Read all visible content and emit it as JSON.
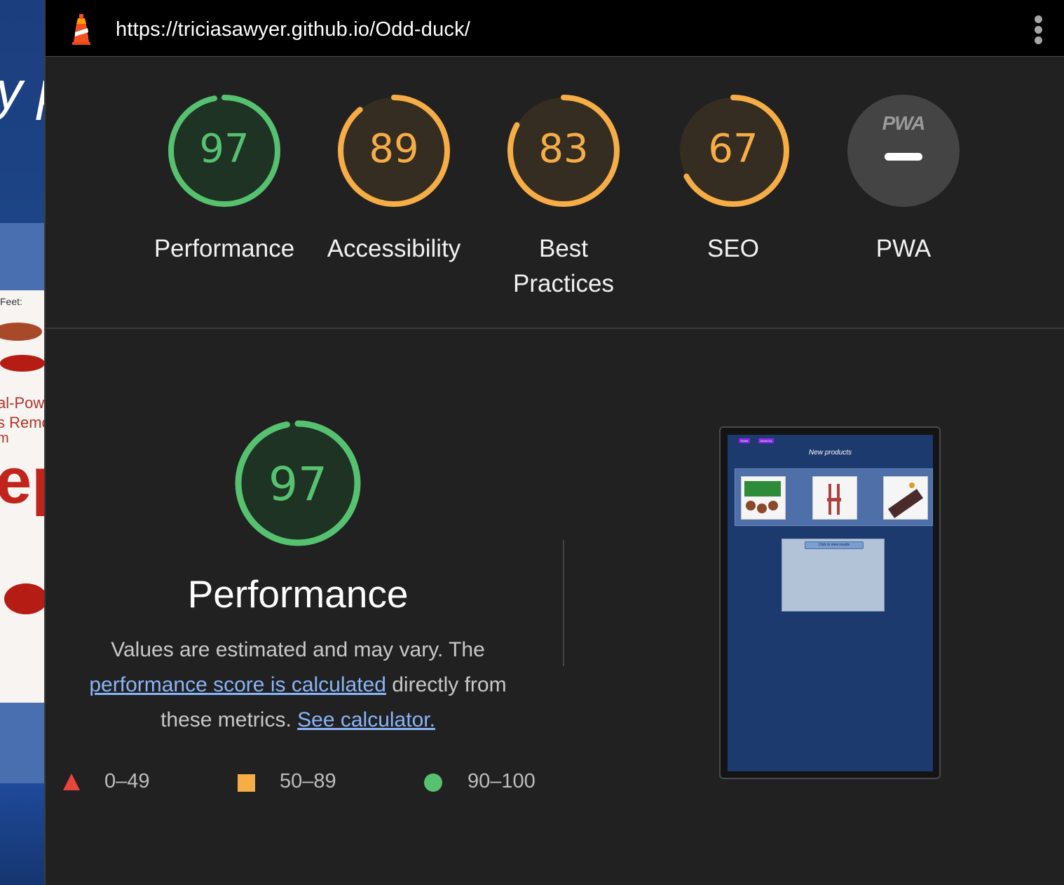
{
  "background_page": {
    "heading_fragment": "y p",
    "photo_texts": [
      "Feet:",
      "al-Pow",
      "s Remo",
      "m",
      "ep"
    ]
  },
  "toolbar": {
    "url": "https://triciasawyer.github.io/Odd-duck/",
    "logo_icon": "lighthouse-icon",
    "menu_icon": "kebab-menu-icon"
  },
  "scores": [
    {
      "label": "Performance",
      "score": "97",
      "value": 97,
      "status": "pass",
      "color": "#56c270",
      "ring_bg": "#1f3325"
    },
    {
      "label": "Accessibility",
      "score": "89",
      "value": 89,
      "status": "average",
      "color": "#f6ad45",
      "ring_bg": "#352d22"
    },
    {
      "label": "Best Practices",
      "label_line1": "Best",
      "label_line2": "Practices",
      "score": "83",
      "value": 83,
      "status": "average",
      "color": "#f6ad45",
      "ring_bg": "#352d22"
    },
    {
      "label": "SEO",
      "score": "67",
      "value": 67,
      "status": "average",
      "color": "#f6ad45",
      "ring_bg": "#352d22"
    },
    {
      "label": "PWA",
      "badge_text": "PWA",
      "status": "not-applicable",
      "color": "#444444"
    }
  ],
  "detail": {
    "score": "97",
    "value": 97,
    "title": "Performance",
    "desc_part1": "Values are estimated and may vary. The",
    "link1": "performance score is calculated",
    "desc_part2": " directly from these metrics.",
    "link2": "See calculator."
  },
  "legend": [
    {
      "range": "0–49",
      "shape": "triangle",
      "color": "#e8453c"
    },
    {
      "range": "50–89",
      "shape": "square",
      "color": "#f6ad45"
    },
    {
      "range": "90–100",
      "shape": "circle",
      "color": "#56c270"
    }
  ],
  "screenshot_thumbnail": {
    "nav": [
      "Home",
      "About Us"
    ],
    "title": "New products",
    "button": "Click to view results"
  }
}
